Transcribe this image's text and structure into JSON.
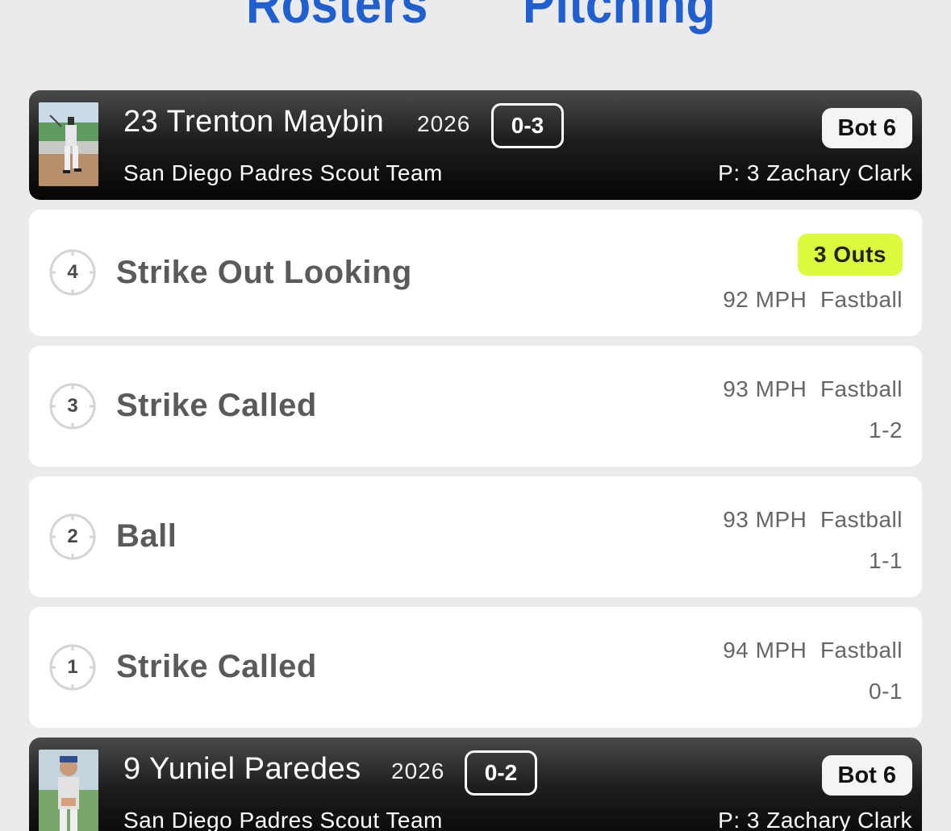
{
  "tabs": {
    "rosters": "Rosters",
    "pitching": "Pitching"
  },
  "colors": {
    "accent": "#1f5fcf",
    "outs_badge": "#dcfb3c"
  },
  "at_bats": [
    {
      "batter": "23 Trenton Maybin",
      "year": "2026",
      "count": "0-3",
      "inning": "Bot 6",
      "team": "San Diego Padres Scout Team",
      "pitcher": "P: 3 Zachary Clark",
      "pitches": [
        {
          "number": "4",
          "result": "Strike Out Looking",
          "outs": "3 Outs",
          "speed": "92 MPH",
          "pitch_type": "Fastball"
        },
        {
          "number": "3",
          "result": "Strike Called",
          "speed": "93 MPH",
          "pitch_type": "Fastball",
          "count": "1-2"
        },
        {
          "number": "2",
          "result": "Ball",
          "speed": "93 MPH",
          "pitch_type": "Fastball",
          "count": "1-1"
        },
        {
          "number": "1",
          "result": "Strike Called",
          "speed": "94 MPH",
          "pitch_type": "Fastball",
          "count": "0-1"
        }
      ]
    },
    {
      "batter": "9 Yuniel Paredes",
      "year": "2026",
      "count": "0-2",
      "inning": "Bot 6",
      "team": "San Diego Padres Scout Team",
      "pitcher": "P: 3 Zachary Clark"
    }
  ],
  "icons": {
    "pitch": "baseball-icon",
    "player_photo": "player-photo"
  }
}
